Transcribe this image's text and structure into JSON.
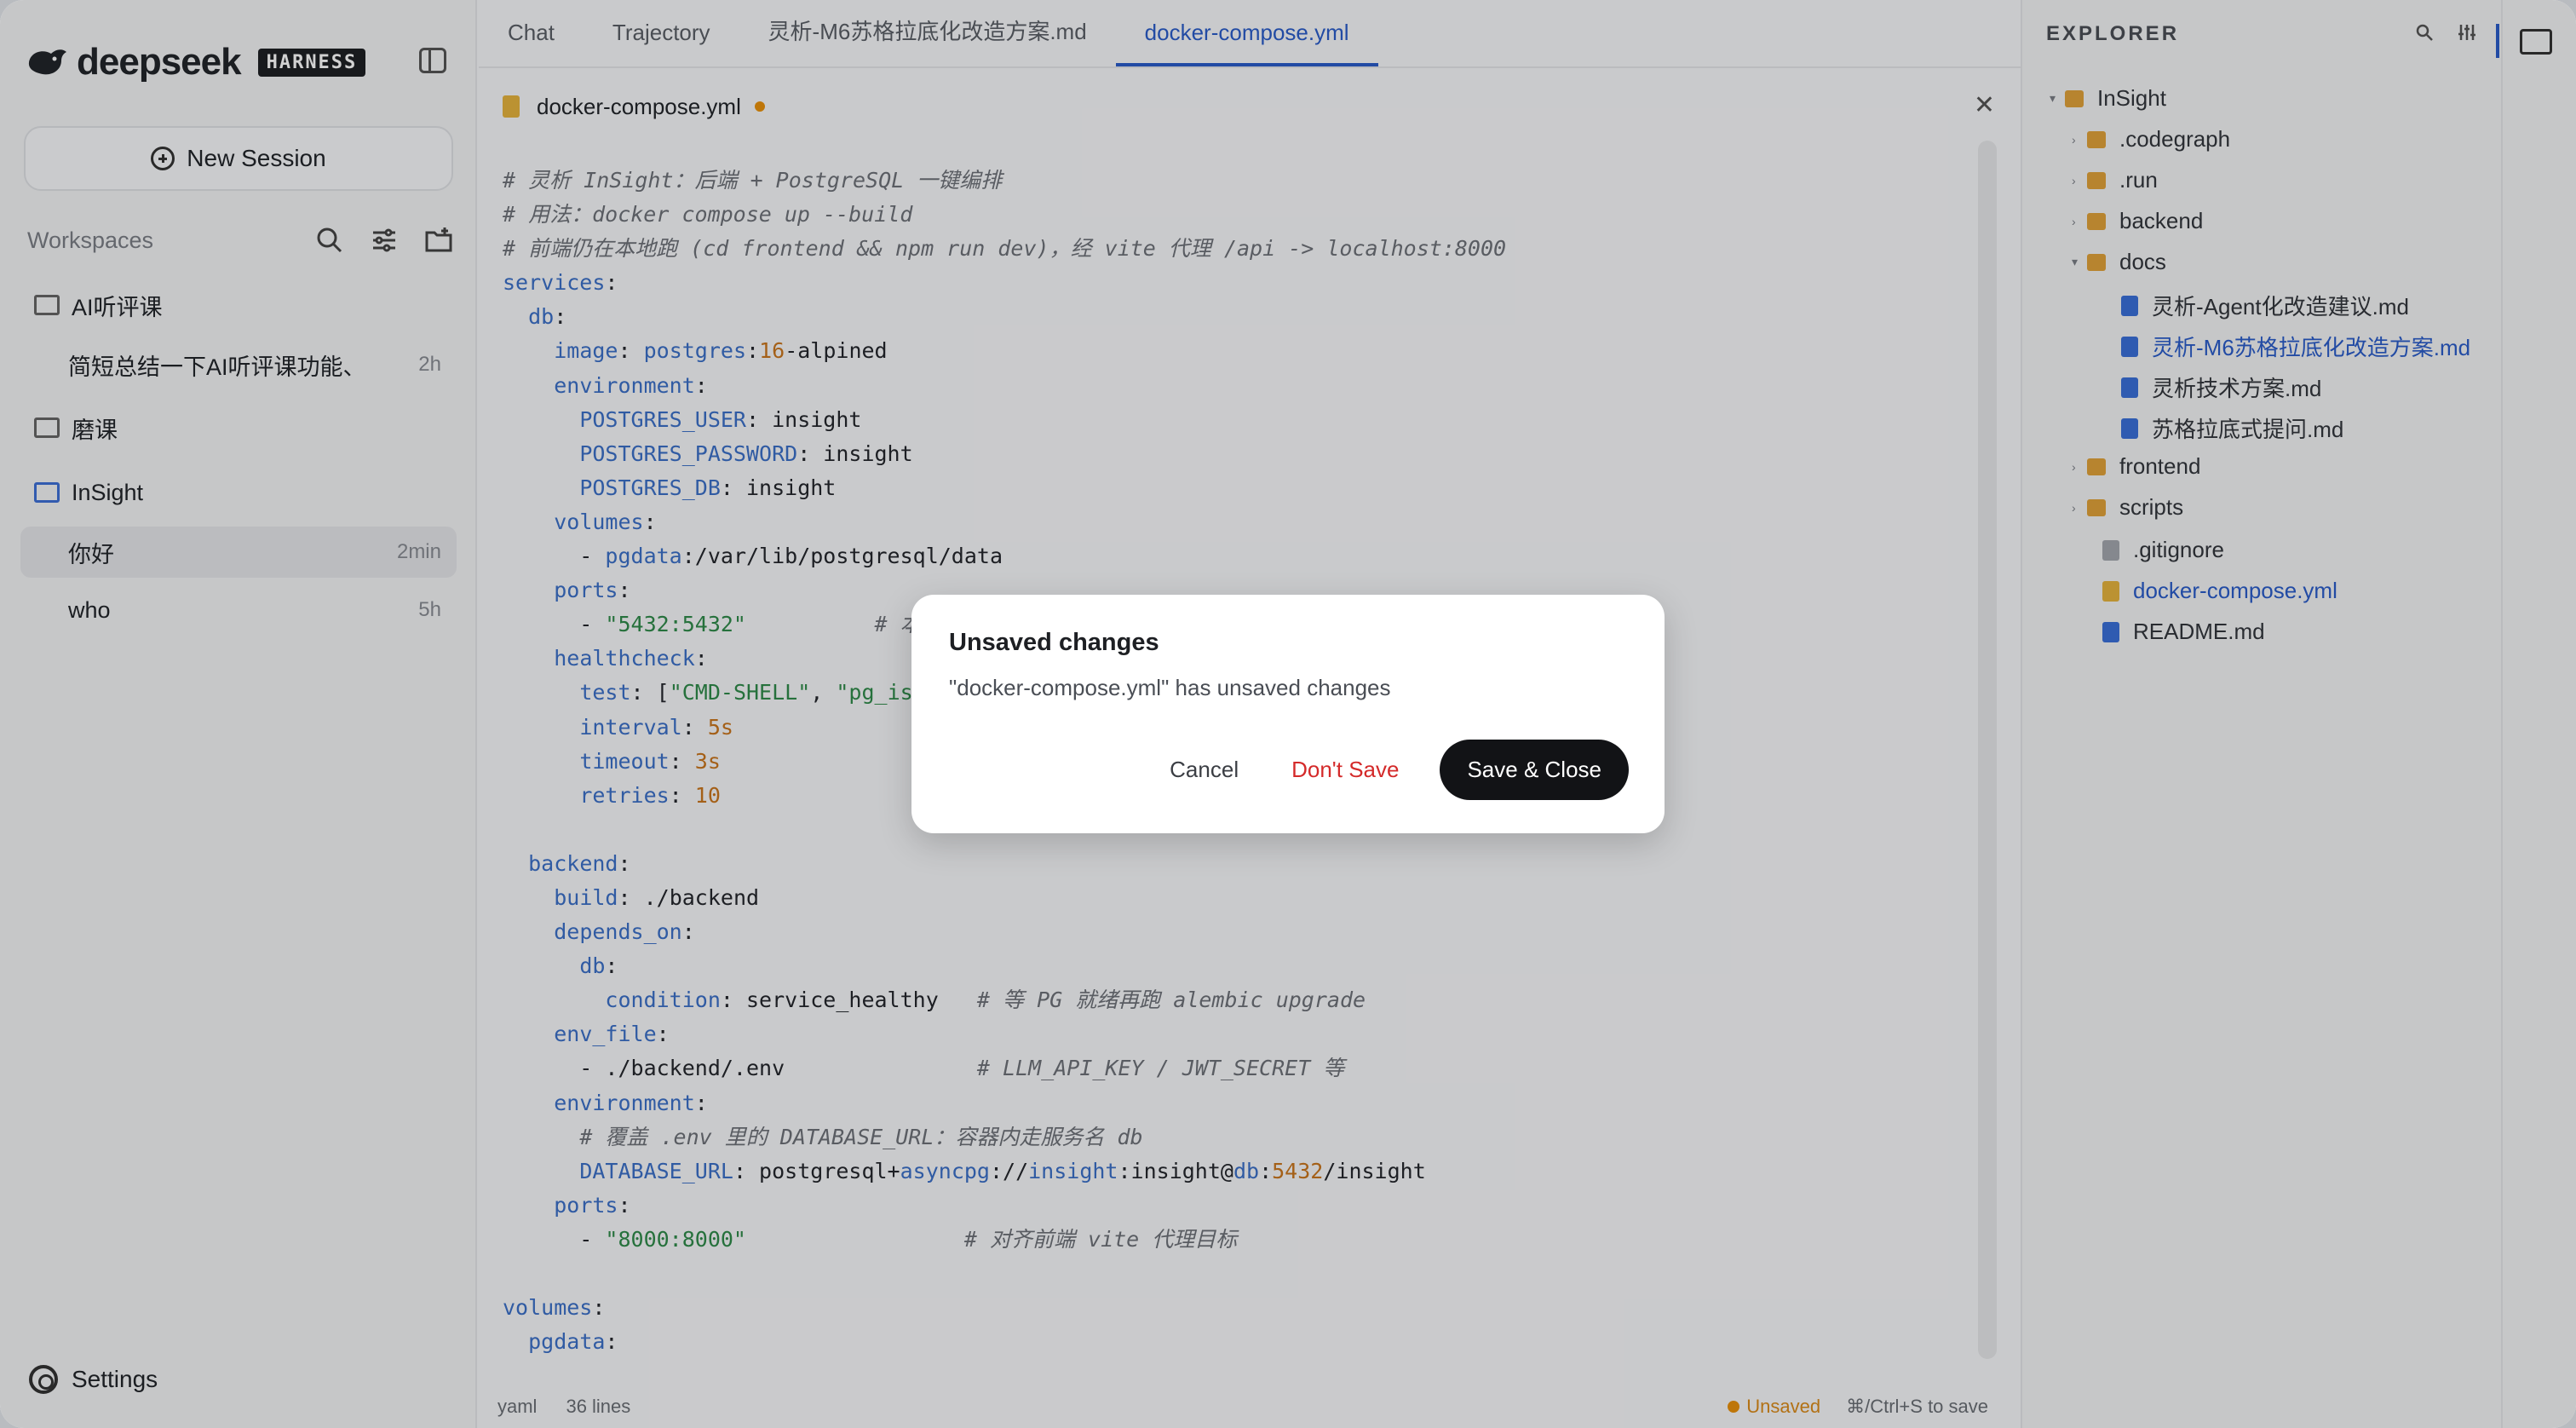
{
  "sidebar": {
    "logo_text": "deepseek",
    "badge": "HARNESS",
    "new_session": "New Session",
    "workspaces_label": "Workspaces",
    "workspaces": [
      {
        "name": "AI听评课",
        "sessions": [
          {
            "title": "简短总结一下AI听评课功能、",
            "time": "2h"
          }
        ]
      },
      {
        "name": "磨课",
        "sessions": []
      },
      {
        "name": "InSight",
        "sessions": [
          {
            "title": "你好",
            "time": "2min"
          },
          {
            "title": "who",
            "time": "5h"
          }
        ]
      }
    ],
    "settings": "Settings"
  },
  "tabs": [
    "Chat",
    "Trajectory",
    "灵析-M6苏格拉底化改造方案.md",
    "docker-compose.yml"
  ],
  "active_tab": 3,
  "editor": {
    "filename": "docker-compose.yml",
    "status_lang": "yaml",
    "status_lines": "36 lines",
    "status_unsaved": "Unsaved",
    "status_hint": "⌘/Ctrl+S to save"
  },
  "explorer": {
    "title": "EXPLORER",
    "root": "InSight",
    "items": [
      ".codegraph",
      ".run",
      "backend",
      "docs",
      "灵析-Agent化改造建议.md",
      "灵析-M6苏格拉底化改造方案.md",
      "灵析技术方案.md",
      "苏格拉底式提问.md",
      "frontend",
      "scripts",
      ".gitignore",
      "docker-compose.yml",
      "README.md"
    ]
  },
  "modal": {
    "title": "Unsaved changes",
    "message": "\"docker-compose.yml\" has unsaved changes",
    "cancel": "Cancel",
    "dont_save": "Don't Save",
    "save_close": "Save & Close"
  },
  "colors": {
    "accent": "#2a5cc9",
    "danger": "#d42a2a",
    "unsaved": "#e8900c"
  },
  "icons": [
    "whale-logo-icon",
    "sidebar-toggle-icon",
    "plus-circle-icon",
    "search-icon",
    "filter-icon",
    "new-folder-icon",
    "folder-icon",
    "gear-icon",
    "yml-file-icon",
    "close-icon",
    "md-file-icon"
  ]
}
